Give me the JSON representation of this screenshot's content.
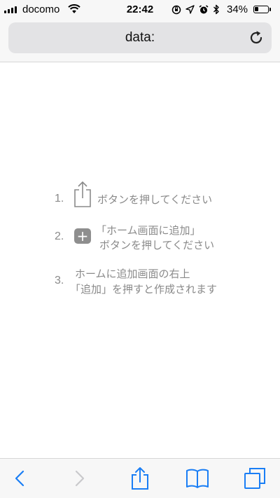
{
  "status_bar": {
    "carrier": "docomo",
    "time": "22:42",
    "battery_percent": "34%",
    "battery_level": 0.34,
    "icons": [
      "signal-icon",
      "wifi-icon",
      "screen-rotation-lock-icon",
      "location-arrow-icon",
      "alarm-icon",
      "bluetooth-icon",
      "battery-icon"
    ]
  },
  "address_bar": {
    "url": "data:",
    "reload_icon": "reload-icon"
  },
  "instructions": {
    "steps": [
      {
        "number": "1.",
        "icon": "share-icon",
        "lines": [
          "ボタンを押してください"
        ]
      },
      {
        "number": "2.",
        "icon": "plus-icon",
        "lines": [
          "「ホーム画面に追加」",
          "ボタンを押してください"
        ]
      },
      {
        "number": "3.",
        "lines": [
          "ホームに追加画面の右上",
          "「追加」を押すと作成されます"
        ]
      }
    ]
  },
  "toolbar": {
    "items": [
      "back-icon",
      "forward-icon",
      "share-icon",
      "bookmarks-icon",
      "tabs-icon"
    ]
  },
  "colors": {
    "accent": "#1a7ef5",
    "text_gray": "#8a8a8a",
    "bar_bg": "#f7f7f7",
    "url_field_bg": "#e3e3e5"
  }
}
